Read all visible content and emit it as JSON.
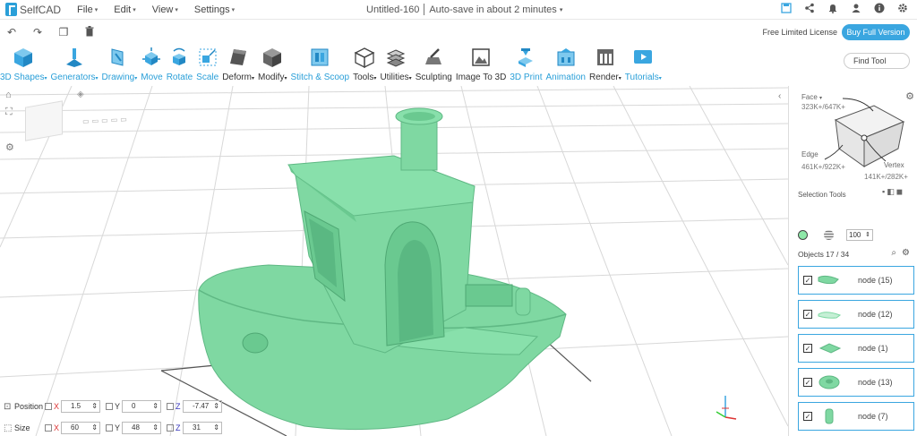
{
  "app": {
    "logo_text": "SelfCAD",
    "doc_title": "Untitled-160",
    "autosave": "Auto-save in about 2 minutes",
    "autosave_caret": "▾"
  },
  "menu": [
    {
      "label": "File",
      "caret": "▾"
    },
    {
      "label": "Edit",
      "caret": "▾"
    },
    {
      "label": "View",
      "caret": "▾"
    },
    {
      "label": "Settings",
      "caret": "▾"
    }
  ],
  "top_icons": [
    "save-icon",
    "share-icon",
    "bell-icon",
    "user-icon",
    "info-icon",
    "gear-icon"
  ],
  "license": {
    "text": "Free Limited License",
    "buy_label": "Buy Full Version"
  },
  "toolbar": {
    "items": [
      {
        "label": "3D Shapes",
        "caret": "▾",
        "color": "blue"
      },
      {
        "label": "Generators",
        "caret": "▾",
        "color": "blue"
      },
      {
        "label": "Drawing",
        "caret": "▾",
        "color": "blue"
      },
      {
        "label": "Move",
        "caret": "",
        "color": "blue"
      },
      {
        "label": "Rotate",
        "caret": "",
        "color": "blue"
      },
      {
        "label": "Scale",
        "caret": "",
        "color": "blue"
      },
      {
        "label": "Deform",
        "caret": "▾",
        "color": "gray"
      },
      {
        "label": "Modify",
        "caret": "▾",
        "color": "gray"
      },
      {
        "label": "Stitch & Scoop",
        "caret": "",
        "color": "blue"
      },
      {
        "label": "Tools",
        "caret": "▾",
        "color": "gray"
      },
      {
        "label": "Utilities",
        "caret": "▾",
        "color": "gray"
      },
      {
        "label": "Sculpting",
        "caret": "",
        "color": "gray"
      },
      {
        "label": "Image To 3D",
        "caret": "",
        "color": "gray"
      },
      {
        "label": "3D Print",
        "caret": "",
        "color": "blue"
      },
      {
        "label": "Animation",
        "caret": "",
        "color": "blue"
      },
      {
        "label": "Render",
        "caret": "▾",
        "color": "gray"
      },
      {
        "label": "Tutorials",
        "caret": "▾",
        "color": "blue"
      }
    ],
    "find_tool_placeholder": "Find Tool"
  },
  "selection": {
    "face_label": "Face",
    "face_count": "323K+/647K+",
    "edge_label": "Edge",
    "edge_count": "461K+/922K+",
    "vertex_label": "Vertex",
    "vertex_count": "141K+/282K+",
    "tools_label": "Selection Tools",
    "brush_size": "100"
  },
  "objects": {
    "header": "Objects 17 / 34",
    "items": [
      {
        "name": "node (15)"
      },
      {
        "name": "node (12)"
      },
      {
        "name": "node (1)"
      },
      {
        "name": "node (13)"
      },
      {
        "name": "node (7)"
      }
    ]
  },
  "transform": {
    "position_label": "Position",
    "size_label": "Size",
    "position": {
      "x": "1.5",
      "y": "0",
      "z": "-7.47"
    },
    "size": {
      "x": "60",
      "y": "48",
      "z": "31"
    },
    "axis_x": "X",
    "axis_y": "Y",
    "axis_z": "Z"
  },
  "colors": {
    "accent": "#3aa6e0",
    "model": "#7fd8a2",
    "model_shadow": "#5fb884"
  }
}
